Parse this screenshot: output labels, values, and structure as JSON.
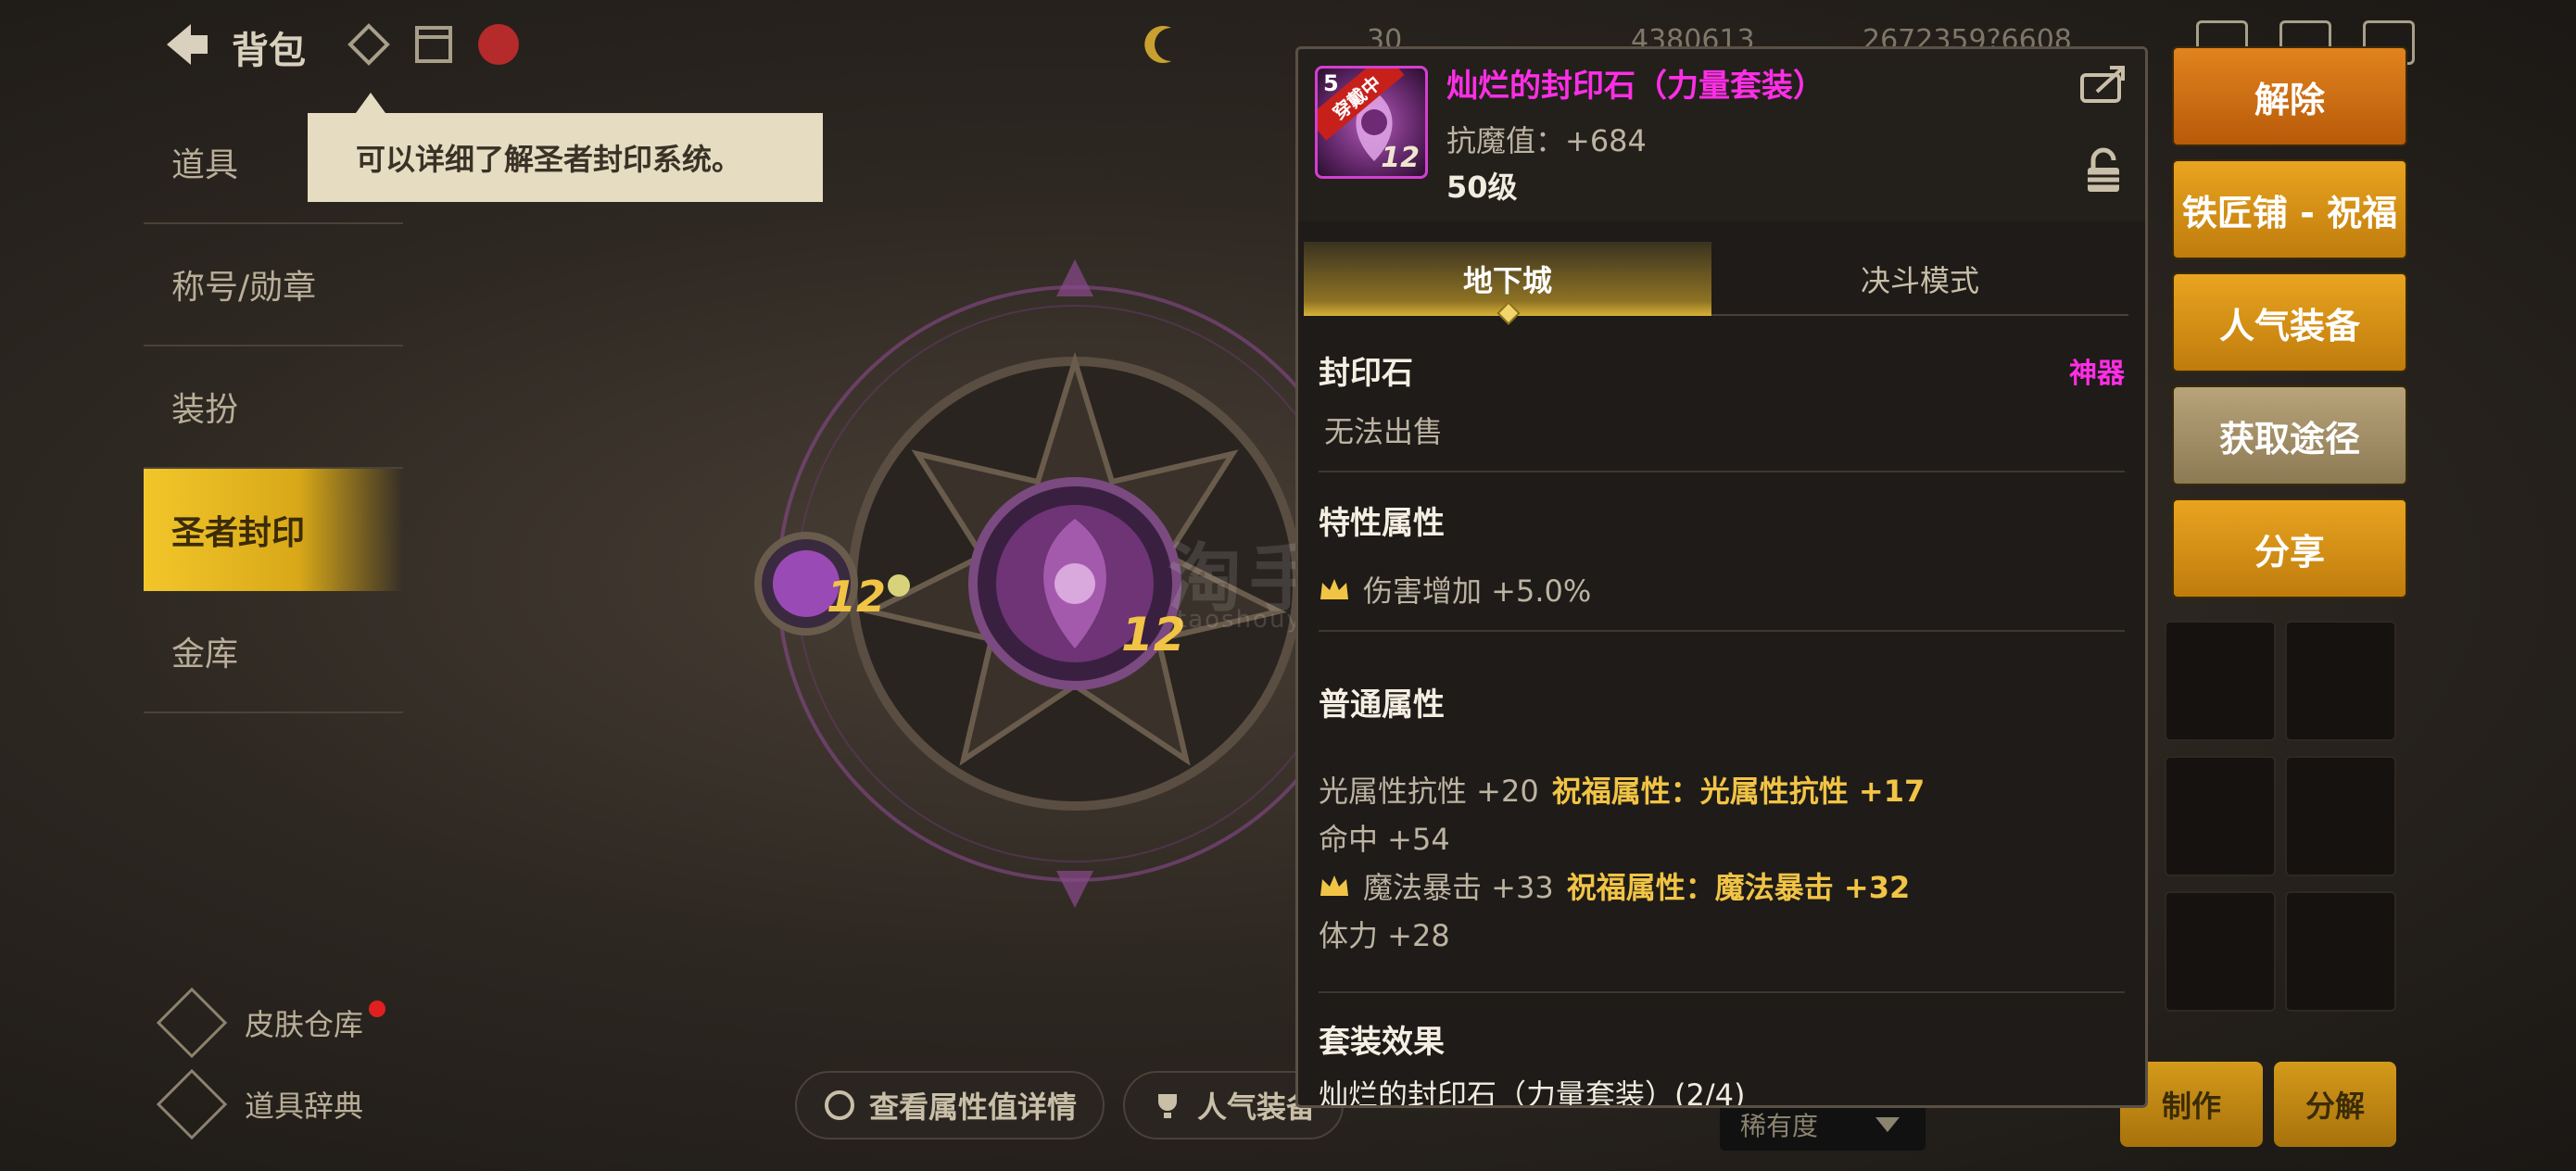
{
  "topbar": {
    "title": "背包",
    "currencies": [
      "30",
      "4380613",
      "2672359?6608"
    ]
  },
  "hint": {
    "text": "可以详细了解圣者封印系统。"
  },
  "left_menu": {
    "items": [
      {
        "label": "道具",
        "active": false
      },
      {
        "label": "称号/勋章",
        "active": false
      },
      {
        "label": "装扮",
        "active": false
      },
      {
        "label": "圣者封印",
        "active": true
      },
      {
        "label": "金库",
        "active": false
      }
    ]
  },
  "bottom_left": {
    "skin_warehouse": "皮肤仓库",
    "item_dictionary": "道具辞典"
  },
  "bottom_center": {
    "view_stats": "查看属性值详情",
    "popular": "人气装备"
  },
  "seal": {
    "small_level": "12",
    "center_level": "12"
  },
  "watermark": {
    "text": "淘手游",
    "sub": "taoshouyou.com"
  },
  "bottom_right": {
    "rarity": "稀有度",
    "craft": "制作",
    "disassemble": "分解"
  },
  "item": {
    "grade": "5",
    "equipped_tag": "穿戴中",
    "level_badge": "12",
    "name": "灿烂的封印石（力量套装）",
    "anti_magic": "抗魔值：+684",
    "required_level": "50级",
    "tabs": [
      {
        "label": "地下城",
        "active": true
      },
      {
        "label": "决斗模式",
        "active": false
      }
    ],
    "type_label": "封印石",
    "rarity_label": "神器",
    "sell_note": "无法出售",
    "special_title": "特性属性",
    "special_stat": "伤害增加 +5.0%",
    "normal_title": "普通属性",
    "normal_rows": [
      {
        "stat": "光属性抗性 +20",
        "bless_label": "祝福属性：",
        "bless_value": "光属性抗性 +17",
        "crown": false
      },
      {
        "stat": "命中 +54",
        "bless_label": "",
        "bless_value": "",
        "crown": false
      },
      {
        "stat": "魔法暴击 +33",
        "bless_label": "祝福属性：",
        "bless_value": "魔法暴击 +32",
        "crown": true
      },
      {
        "stat": "体力 +28",
        "bless_label": "",
        "bless_value": "",
        "crown": false
      }
    ],
    "set_title": "套装效果",
    "set_line": "灿烂的封印石（力量套装）(2/4)"
  },
  "actions": {
    "remove": "解除",
    "blacksmith": "铁匠铺 - 祝福",
    "popular_equip": "人气装备",
    "obtain": "获取途径",
    "share": "分享"
  },
  "colors": {
    "item_name": "#ff2ee6",
    "bless": "#f1c445",
    "active_tab": "#d8b236"
  }
}
